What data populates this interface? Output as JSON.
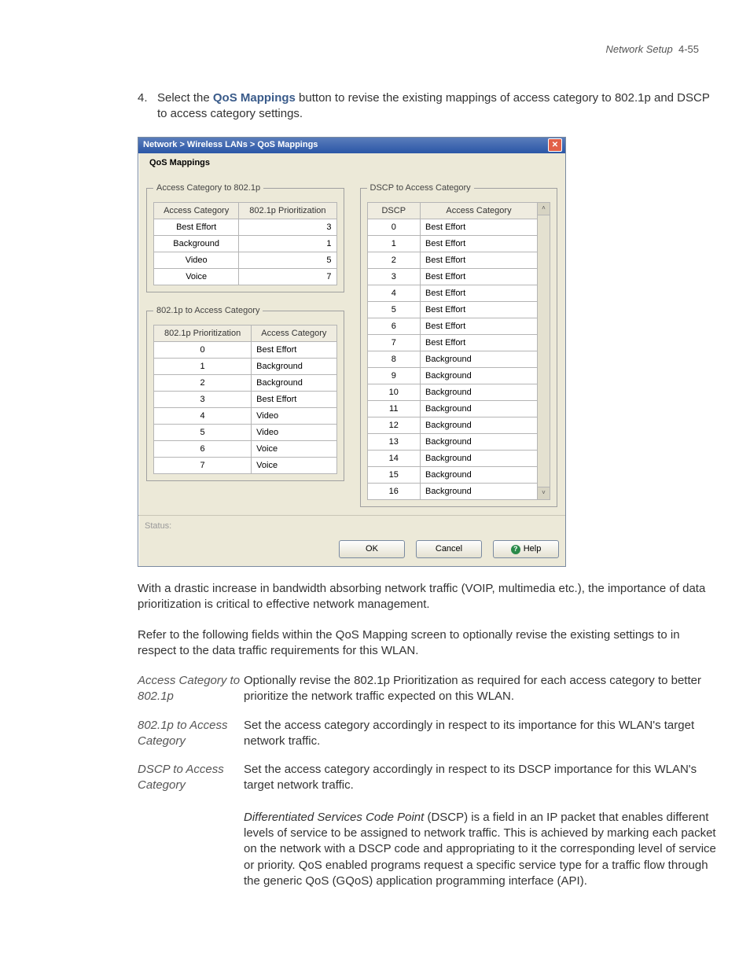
{
  "header": {
    "section": "Network Setup",
    "page": "4-55"
  },
  "step": {
    "num": "4.",
    "prefix": "Select the ",
    "button_name": "QoS Mappings",
    "suffix": " button to revise the existing mappings of access category to 802.1p and DSCP to access category settings."
  },
  "dialog": {
    "breadcrumb": "Network  >  Wireless LANs  >  QoS Mappings",
    "tab": "QoS Mappings",
    "close_glyph": "✕",
    "fs1": {
      "legend": "Access Category to 802.1p",
      "h1": "Access Category",
      "h2": "802.1p Prioritization",
      "rows": [
        {
          "a": "Best Effort",
          "b": "3"
        },
        {
          "a": "Background",
          "b": "1"
        },
        {
          "a": "Video",
          "b": "5"
        },
        {
          "a": "Voice",
          "b": "7"
        }
      ]
    },
    "fs2": {
      "legend": "802.1p to Access Category",
      "h1": "802.1p Prioritization",
      "h2": "Access Category",
      "rows": [
        {
          "a": "0",
          "b": "Best Effort"
        },
        {
          "a": "1",
          "b": "Background"
        },
        {
          "a": "2",
          "b": "Background"
        },
        {
          "a": "3",
          "b": "Best Effort"
        },
        {
          "a": "4",
          "b": "Video"
        },
        {
          "a": "5",
          "b": "Video"
        },
        {
          "a": "6",
          "b": "Voice"
        },
        {
          "a": "7",
          "b": "Voice"
        }
      ]
    },
    "fs3": {
      "legend": "DSCP to Access Category",
      "h1": "DSCP",
      "h2": "Access Category",
      "rows": [
        {
          "a": "0",
          "b": "Best Effort"
        },
        {
          "a": "1",
          "b": "Best Effort"
        },
        {
          "a": "2",
          "b": "Best Effort"
        },
        {
          "a": "3",
          "b": "Best Effort"
        },
        {
          "a": "4",
          "b": "Best Effort"
        },
        {
          "a": "5",
          "b": "Best Effort"
        },
        {
          "a": "6",
          "b": "Best Effort"
        },
        {
          "a": "7",
          "b": "Best Effort"
        },
        {
          "a": "8",
          "b": "Background"
        },
        {
          "a": "9",
          "b": "Background"
        },
        {
          "a": "10",
          "b": "Background"
        },
        {
          "a": "11",
          "b": "Background"
        },
        {
          "a": "12",
          "b": "Background"
        },
        {
          "a": "13",
          "b": "Background"
        },
        {
          "a": "14",
          "b": "Background"
        },
        {
          "a": "15",
          "b": "Background"
        },
        {
          "a": "16",
          "b": "Background"
        }
      ]
    },
    "status_label": "Status:",
    "ok": "OK",
    "cancel": "Cancel",
    "help": "Help",
    "scroll_up": "˄",
    "scroll_down": "˅"
  },
  "para1": "With a drastic increase in bandwidth absorbing network traffic (VOIP, multimedia etc.), the importance of data prioritization is critical to effective network management.",
  "para2": "Refer to the following fields within the QoS Mapping screen to optionally revise the existing settings to in respect to the data traffic requirements for this WLAN.",
  "defs": {
    "d1": {
      "term": "Access Category to 802.1p",
      "desc": "Optionally revise the 802.1p Prioritization as required for each access category to better prioritize the network traffic expected on this WLAN."
    },
    "d2": {
      "term": "802.1p to Access Category",
      "desc": "Set the access category accordingly in respect to its importance for this WLAN's target network traffic."
    },
    "d3": {
      "term": "DSCP to Access Category",
      "desc1": "Set the access category accordingly in respect to its DSCP importance for this WLAN's target network traffic.",
      "italic": "Differentiated Services Code Point",
      "desc2": " (DSCP) is a field in an IP packet that enables different levels of service to be assigned to network traffic. This is achieved by marking each packet on the network with a DSCP code and appropriating to it the corresponding level of service or priority. QoS enabled programs request a specific service type for a traffic flow through the generic QoS (GQoS) application programming interface (API)."
    }
  }
}
